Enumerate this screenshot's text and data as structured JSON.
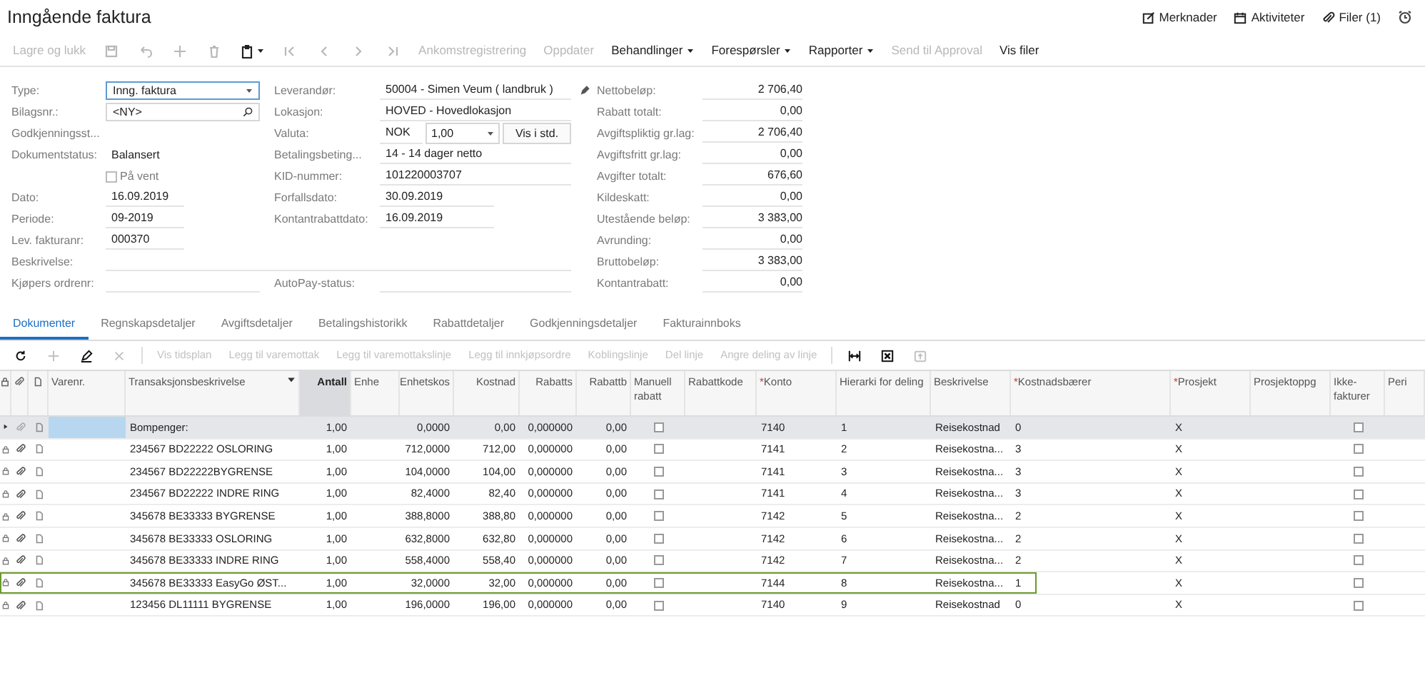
{
  "window": {
    "title": "Inngående faktura"
  },
  "header_links": [
    {
      "kind": "notes",
      "label": "Merknader"
    },
    {
      "kind": "activities",
      "label": "Aktiviteter"
    },
    {
      "kind": "files",
      "label": "Filer (1)"
    },
    {
      "kind": "clock"
    }
  ],
  "toolbar": [
    {
      "kind": "text",
      "label": "Lagre og lukk",
      "disabled": true
    },
    {
      "kind": "save",
      "disabled": true
    },
    {
      "kind": "undo",
      "disabled": true
    },
    {
      "kind": "add",
      "disabled": true
    },
    {
      "kind": "delete",
      "disabled": true
    },
    {
      "kind": "clipboard",
      "disabled": false
    },
    {
      "kind": "first",
      "disabled": true
    },
    {
      "kind": "prev",
      "disabled": true
    },
    {
      "kind": "next",
      "disabled": true
    },
    {
      "kind": "last",
      "disabled": true
    },
    {
      "kind": "text",
      "label": "Ankomstregistrering",
      "disabled": true
    },
    {
      "kind": "text",
      "label": "Oppdater",
      "disabled": true
    },
    {
      "kind": "menu",
      "label": "Behandlinger",
      "disabled": false
    },
    {
      "kind": "menu",
      "label": "Forespørsler",
      "disabled": false
    },
    {
      "kind": "menu",
      "label": "Rapporter",
      "disabled": false
    },
    {
      "kind": "text",
      "label": "Send til Approval",
      "disabled": true
    },
    {
      "kind": "text",
      "label": "Vis filer",
      "disabled": false
    }
  ],
  "form_left": [
    {
      "kind": "select",
      "label": "Type:",
      "value": "Inng. faktura"
    },
    {
      "kind": "search",
      "label": "Bilagsnr.:",
      "value": "<NY>"
    },
    {
      "kind": "label",
      "label": "Godkjenningsst..."
    },
    {
      "kind": "text",
      "label": "Dokumentstatus:",
      "value": "Balansert"
    },
    {
      "kind": "checkbox",
      "label": "På vent",
      "checked": false
    },
    {
      "kind": "field",
      "label": "Dato:",
      "value": "16.09.2019"
    },
    {
      "kind": "field",
      "label": "Periode:",
      "value": "09-2019"
    },
    {
      "kind": "field",
      "label": "Lev. fakturanr:",
      "value": "000370"
    },
    {
      "kind": "wide",
      "label": "Beskrivelse:"
    },
    {
      "kind": "field",
      "label": "Kjøpers ordrenr:"
    }
  ],
  "form_middle": [
    {
      "kind": "field",
      "label": "Leverandør:",
      "value": "50004 - Simen Veum ( landbruk )"
    },
    {
      "kind": "field",
      "label": "Lokasjon:",
      "value": "HOVED - Hovedlokasjon"
    },
    {
      "kind": "currency",
      "label": "Valuta:",
      "value": "NOK",
      "rate": "1,00",
      "button": "Vis i std."
    },
    {
      "kind": "field",
      "label": "Betalingsbeting...",
      "value": "14 - 14 dager netto"
    },
    {
      "kind": "field",
      "label": "KID-nummer:",
      "value": "101220003707"
    },
    {
      "kind": "short",
      "label": "Forfallsdato:",
      "value": "30.09.2019"
    },
    {
      "kind": "short",
      "label": "Kontantrabattdato:",
      "value": "16.09.2019"
    },
    {
      "kind": "field",
      "label": "AutoPay-status:"
    }
  ],
  "totals": [
    {
      "label": "Nettobeløp:",
      "value": "2 706,40"
    },
    {
      "label": "Rabatt totalt:",
      "value": "0,00"
    },
    {
      "label": "Avgiftspliktig gr.lag:",
      "value": "2 706,40"
    },
    {
      "label": "Avgiftsfritt gr.lag:",
      "value": "0,00"
    },
    {
      "label": "Avgifter totalt:",
      "value": "676,60"
    },
    {
      "label": "Kildeskatt:",
      "value": "0,00"
    },
    {
      "label": "Utestående beløp:",
      "value": "3 383,00"
    },
    {
      "label": "Avrunding:",
      "value": "0,00"
    },
    {
      "label": "Bruttobeløp:",
      "value": "3 383,00"
    },
    {
      "label": "Kontantrabatt:",
      "value": "0,00"
    }
  ],
  "tabs": [
    {
      "label": "Dokumenter",
      "selected": true
    },
    {
      "label": "Regnskapsdetaljer",
      "selected": false
    },
    {
      "label": "Avgiftsdetaljer",
      "selected": false
    },
    {
      "label": "Betalingshistorikk",
      "selected": false
    },
    {
      "label": "Rabattdetaljer",
      "selected": false
    },
    {
      "label": "Godkjenningsdetaljer",
      "selected": false
    },
    {
      "label": "Fakturainnboks",
      "selected": false
    }
  ],
  "grid_toolbar": [
    {
      "kind": "refresh",
      "disabled": false
    },
    {
      "kind": "add",
      "disabled": true
    },
    {
      "kind": "edit",
      "disabled": false
    },
    {
      "kind": "remove",
      "disabled": true
    },
    {
      "kind": "separator"
    },
    {
      "kind": "text",
      "label": "Vis tidsplan",
      "disabled": true
    },
    {
      "kind": "text",
      "label": "Legg til varemottak",
      "disabled": true
    },
    {
      "kind": "text",
      "label": "Legg til varemottakslinje",
      "disabled": true
    },
    {
      "kind": "text",
      "label": "Legg til innkjøpsordre",
      "disabled": true
    },
    {
      "kind": "text",
      "label": "Koblingslinje",
      "disabled": true
    },
    {
      "kind": "text",
      "label": "Del linje",
      "disabled": true
    },
    {
      "kind": "text",
      "label": "Angre deling av linje",
      "disabled": true
    },
    {
      "kind": "separator"
    },
    {
      "kind": "fit",
      "disabled": false
    },
    {
      "kind": "excel",
      "disabled": false
    },
    {
      "kind": "upload",
      "disabled": true
    }
  ],
  "table": {
    "columns": [
      {
        "label": "Varenr.",
        "active": false
      },
      {
        "label": "Transaksjonsbeskrivelse",
        "active": false
      },
      {
        "label": "Antall",
        "active": true
      },
      {
        "label": "Enhe",
        "active": false
      },
      {
        "label": "Enhetskos",
        "active": false
      },
      {
        "label": "Kostnad",
        "active": false
      },
      {
        "label": "Rabatts",
        "active": false
      },
      {
        "label": "Rabattb",
        "active": false
      },
      {
        "label": "Manuell rabatt",
        "active": false
      },
      {
        "label": "Rabattkode",
        "active": false
      },
      {
        "label": "Konto",
        "marker": "*",
        "active": false
      },
      {
        "label": "Hierarki for deling",
        "active": false
      },
      {
        "label": "Beskrivelse",
        "active": false
      },
      {
        "label": "Kostnadsbærer",
        "marker": "*",
        "active": false
      },
      {
        "label": "Prosjekt",
        "marker": "*",
        "active": false
      },
      {
        "label": "Prosjektoppg",
        "active": false
      },
      {
        "label": "Ikke-fakturer",
        "active": false
      },
      {
        "label": "Peri",
        "active": false
      }
    ],
    "rows": [
      {
        "selected": true,
        "focused": false,
        "attachment": false,
        "description": "Bompenger:",
        "quantity": "1,00",
        "unit_cost": "0,0000",
        "cost": "0,00",
        "discount_pct": "0,000000",
        "discount_amount": "0,00",
        "manual_discount": false,
        "account": "7140",
        "hierarchy": "1",
        "text": "Reisekostnad",
        "cost_bearer": "0",
        "project": "X",
        "no_invoice": false
      },
      {
        "selected": false,
        "focused": false,
        "attachment": true,
        "description": "234567 BD22222 OSLORING",
        "quantity": "1,00",
        "unit_cost": "712,0000",
        "cost": "712,00",
        "discount_pct": "0,000000",
        "discount_amount": "0,00",
        "manual_discount": false,
        "account": "7141",
        "hierarchy": "2",
        "text": "Reisekostna...",
        "cost_bearer": "3",
        "project": "X",
        "no_invoice": false
      },
      {
        "selected": false,
        "focused": false,
        "attachment": true,
        "description": "234567 BD22222BYGRENSE",
        "quantity": "1,00",
        "unit_cost": "104,0000",
        "cost": "104,00",
        "discount_pct": "0,000000",
        "discount_amount": "0,00",
        "manual_discount": false,
        "account": "7141",
        "hierarchy": "3",
        "text": "Reisekostna...",
        "cost_bearer": "3",
        "project": "X",
        "no_invoice": false
      },
      {
        "selected": false,
        "focused": false,
        "attachment": true,
        "description": "234567 BD22222 INDRE RING",
        "quantity": "1,00",
        "unit_cost": "82,4000",
        "cost": "82,40",
        "discount_pct": "0,000000",
        "discount_amount": "0,00",
        "manual_discount": false,
        "account": "7141",
        "hierarchy": "4",
        "text": "Reisekostna...",
        "cost_bearer": "3",
        "project": "X",
        "no_invoice": false
      },
      {
        "selected": false,
        "focused": false,
        "attachment": true,
        "description": "345678 BE33333 BYGRENSE",
        "quantity": "1,00",
        "unit_cost": "388,8000",
        "cost": "388,80",
        "discount_pct": "0,000000",
        "discount_amount": "0,00",
        "manual_discount": false,
        "account": "7142",
        "hierarchy": "5",
        "text": "Reisekostna...",
        "cost_bearer": "2",
        "project": "X",
        "no_invoice": false
      },
      {
        "selected": false,
        "focused": false,
        "attachment": true,
        "description": "345678 BE33333 OSLORING",
        "quantity": "1,00",
        "unit_cost": "632,8000",
        "cost": "632,80",
        "discount_pct": "0,000000",
        "discount_amount": "0,00",
        "manual_discount": false,
        "account": "7142",
        "hierarchy": "6",
        "text": "Reisekostna...",
        "cost_bearer": "2",
        "project": "X",
        "no_invoice": false
      },
      {
        "selected": false,
        "focused": false,
        "attachment": true,
        "description": "345678 BE33333 INDRE RING",
        "quantity": "1,00",
        "unit_cost": "558,4000",
        "cost": "558,40",
        "discount_pct": "0,000000",
        "discount_amount": "0,00",
        "manual_discount": false,
        "account": "7142",
        "hierarchy": "7",
        "text": "Reisekostna...",
        "cost_bearer": "2",
        "project": "X",
        "no_invoice": false
      },
      {
        "selected": false,
        "focused": true,
        "attachment": true,
        "description": "345678 BE33333 EasyGo ØST...",
        "quantity": "1,00",
        "unit_cost": "32,0000",
        "cost": "32,00",
        "discount_pct": "0,000000",
        "discount_amount": "0,00",
        "manual_discount": false,
        "account": "7144",
        "hierarchy": "8",
        "text": "Reisekostna...",
        "cost_bearer": "1",
        "project": "X",
        "no_invoice": false
      },
      {
        "selected": false,
        "focused": false,
        "attachment": true,
        "description": "123456 DL11111 BYGRENSE",
        "quantity": "1,00",
        "unit_cost": "196,0000",
        "cost": "196,00",
        "discount_pct": "0,000000",
        "discount_amount": "0,00",
        "manual_discount": false,
        "account": "7140",
        "hierarchy": "9",
        "text": "Reisekostnad",
        "cost_bearer": "0",
        "project": "X",
        "no_invoice": false
      }
    ]
  }
}
